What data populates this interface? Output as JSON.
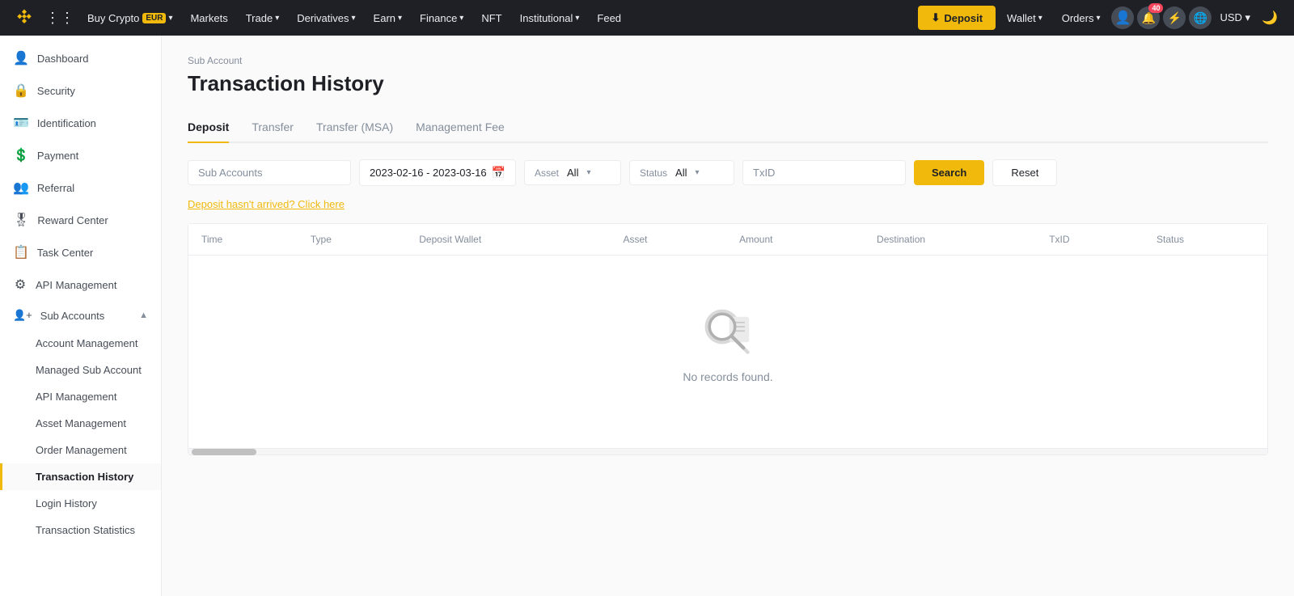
{
  "topnav": {
    "brand": "BINANCE",
    "grid_icon": "⊞",
    "nav_items": [
      {
        "label": "Buy Crypto",
        "badge": "EUR",
        "has_arrow": true
      },
      {
        "label": "Markets",
        "has_arrow": false
      },
      {
        "label": "Trade",
        "has_arrow": true
      },
      {
        "label": "Derivatives",
        "has_arrow": true
      },
      {
        "label": "Earn",
        "has_arrow": true
      },
      {
        "label": "Finance",
        "has_arrow": true
      },
      {
        "label": "NFT",
        "has_arrow": false
      },
      {
        "label": "Institutional",
        "has_arrow": true
      },
      {
        "label": "Feed",
        "has_arrow": false
      }
    ],
    "deposit_label": "Deposit",
    "wallet_label": "Wallet",
    "orders_label": "Orders",
    "notification_count": "40",
    "currency_label": "USD"
  },
  "sidebar": {
    "items": [
      {
        "id": "dashboard",
        "icon": "👤",
        "label": "Dashboard"
      },
      {
        "id": "security",
        "icon": "🔒",
        "label": "Security"
      },
      {
        "id": "identification",
        "icon": "🪪",
        "label": "Identification"
      },
      {
        "id": "payment",
        "icon": "💰",
        "label": "Payment"
      },
      {
        "id": "referral",
        "icon": "👥",
        "label": "Referral"
      },
      {
        "id": "reward-center",
        "icon": "🎁",
        "label": "Reward Center"
      },
      {
        "id": "task-center",
        "icon": "📋",
        "label": "Task Center"
      },
      {
        "id": "api-management",
        "icon": "⚙️",
        "label": "API Management"
      },
      {
        "id": "sub-accounts",
        "icon": "👤👤",
        "label": "Sub Accounts",
        "expanded": true
      }
    ],
    "sub_items": [
      {
        "id": "account-management",
        "label": "Account Management"
      },
      {
        "id": "managed-sub-account",
        "label": "Managed Sub Account"
      },
      {
        "id": "api-management-sub",
        "label": "API Management"
      },
      {
        "id": "asset-management",
        "label": "Asset Management"
      },
      {
        "id": "order-management",
        "label": "Order Management"
      },
      {
        "id": "transaction-history",
        "label": "Transaction History",
        "active": true
      },
      {
        "id": "login-history",
        "label": "Login History"
      },
      {
        "id": "transaction-statistics",
        "label": "Transaction Statistics"
      }
    ]
  },
  "main": {
    "breadcrumb": "Sub Account",
    "page_title": "Transaction History",
    "tabs": [
      {
        "id": "deposit",
        "label": "Deposit",
        "active": true
      },
      {
        "id": "transfer",
        "label": "Transfer"
      },
      {
        "id": "transfer-msa",
        "label": "Transfer (MSA)"
      },
      {
        "id": "management-fee",
        "label": "Management Fee"
      }
    ],
    "filters": {
      "sub_accounts_placeholder": "Sub Accounts",
      "date_range": "2023-02-16 - 2023-03-16",
      "asset_label": "Asset",
      "asset_value": "All",
      "status_label": "Status",
      "status_value": "All",
      "txid_placeholder": "TxID",
      "search_btn": "Search",
      "reset_btn": "Reset"
    },
    "notice_link": "Deposit hasn't arrived? Click here",
    "table": {
      "columns": [
        "Time",
        "Type",
        "Deposit Wallet",
        "Asset",
        "Amount",
        "Destination",
        "TxID",
        "Status"
      ]
    },
    "empty_state": {
      "text": "No records found."
    }
  }
}
